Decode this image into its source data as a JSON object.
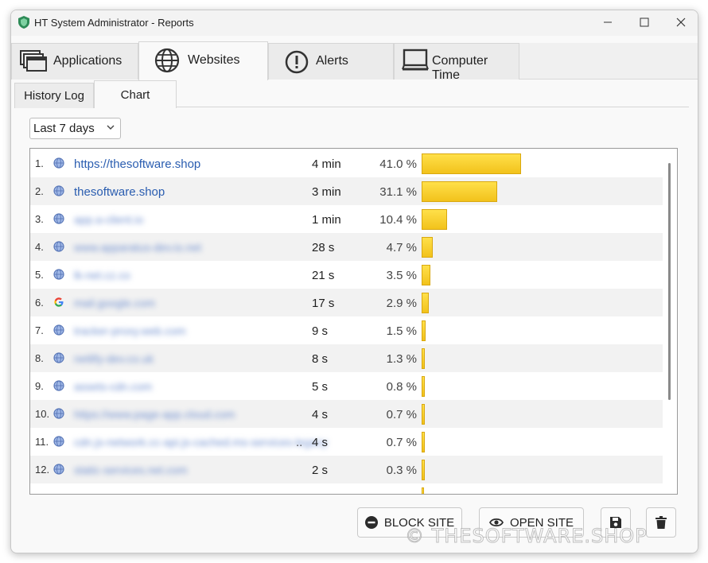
{
  "window": {
    "title": "HT System Administrator - Reports"
  },
  "main_tabs": [
    {
      "label": "Applications",
      "icon": "applications-icon"
    },
    {
      "label": "Websites",
      "icon": "globe-icon",
      "active": true
    },
    {
      "label": "Alerts",
      "icon": "alert-icon"
    },
    {
      "label": "Computer Time",
      "icon": "monitor-icon"
    }
  ],
  "sub_tabs": [
    {
      "label": "History Log"
    },
    {
      "label": "Chart",
      "active": true
    }
  ],
  "range": {
    "selected": "Last 7 days"
  },
  "rows": [
    {
      "num": "1.",
      "site": "https://thesoftware.shop",
      "duration": "4 min",
      "percent": "41.0 %",
      "value": 41.0,
      "blurred": false,
      "icon": "globe-icon"
    },
    {
      "num": "2.",
      "site": "thesoftware.shop",
      "duration": "3 min",
      "percent": "31.1 %",
      "value": 31.1,
      "blurred": false,
      "icon": "globe-icon"
    },
    {
      "num": "3.",
      "site": "",
      "duration": "1 min",
      "percent": "10.4 %",
      "value": 10.4,
      "blurred": true,
      "icon": "globe-icon"
    },
    {
      "num": "4.",
      "site": "",
      "duration": "28 s",
      "percent": "4.7 %",
      "value": 4.7,
      "blurred": true,
      "icon": "globe-icon"
    },
    {
      "num": "5.",
      "site": "",
      "duration": "21 s",
      "percent": "3.5 %",
      "value": 3.5,
      "blurred": true,
      "icon": "globe-icon"
    },
    {
      "num": "6.",
      "site": "",
      "duration": "17 s",
      "percent": "2.9 %",
      "value": 2.9,
      "blurred": true,
      "icon": "google-icon"
    },
    {
      "num": "7.",
      "site": "",
      "duration": "9 s",
      "percent": "1.5 %",
      "value": 1.5,
      "blurred": true,
      "icon": "globe-icon"
    },
    {
      "num": "8.",
      "site": "",
      "duration": "8 s",
      "percent": "1.3 %",
      "value": 1.3,
      "blurred": true,
      "icon": "globe-icon"
    },
    {
      "num": "9.",
      "site": "",
      "duration": "5 s",
      "percent": "0.8 %",
      "value": 0.8,
      "blurred": true,
      "icon": "globe-icon"
    },
    {
      "num": "10.",
      "site": "",
      "duration": "4 s",
      "percent": "0.7 %",
      "value": 0.7,
      "blurred": true,
      "icon": "globe-icon"
    },
    {
      "num": "11.",
      "site": "",
      "duration": "4 s",
      "percent": "0.7 %",
      "value": 0.7,
      "blurred": true,
      "icon": "globe-icon",
      "truncated": true
    },
    {
      "num": "12.",
      "site": "",
      "duration": "2 s",
      "percent": "0.3 %",
      "value": 0.3,
      "blurred": true,
      "icon": "globe-icon"
    }
  ],
  "actions": {
    "block": "BLOCK SITE",
    "open": "OPEN SITE"
  },
  "watermark": "© THESOFTWARE.SHOP",
  "colors": {
    "bar": "#f2c21b",
    "link": "#2a5db0"
  }
}
